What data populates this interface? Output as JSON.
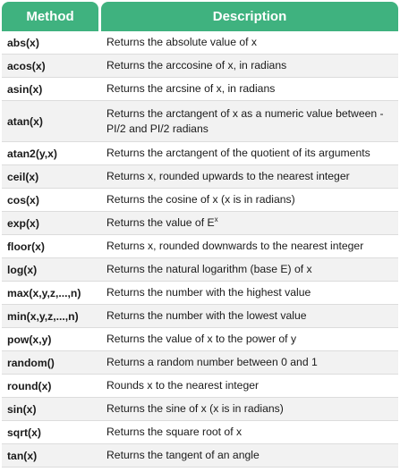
{
  "header": {
    "method": "Method",
    "description": "Description"
  },
  "rows": [
    {
      "method": "abs(x)",
      "description": "Returns the absolute value of x"
    },
    {
      "method": "acos(x)",
      "description": "Returns the arccosine of x, in radians"
    },
    {
      "method": "asin(x)",
      "description": "Returns the arcsine of x, in radians"
    },
    {
      "method": "atan(x)",
      "description": "Returns the arctangent of x as a numeric value between -PI/2 and PI/2 radians"
    },
    {
      "method": "atan2(y,x)",
      "description": "Returns the arctangent of the quotient of its arguments"
    },
    {
      "method": "ceil(x)",
      "description": "Returns x, rounded upwards to the nearest integer"
    },
    {
      "method": "cos(x)",
      "description": "Returns the cosine of x (x is in radians)"
    },
    {
      "method": "exp(x)",
      "description": "Returns the value of E",
      "superscript": "x"
    },
    {
      "method": "floor(x)",
      "description": "Returns x, rounded downwards to the nearest integer"
    },
    {
      "method": "log(x)",
      "description": "Returns the natural logarithm (base E) of x"
    },
    {
      "method": "max(x,y,z,...,n)",
      "description": "Returns the number with the highest value"
    },
    {
      "method": "min(x,y,z,...,n)",
      "description": "Returns the number with the lowest value"
    },
    {
      "method": "pow(x,y)",
      "description": "Returns the value of x to the power of y"
    },
    {
      "method": "random()",
      "description": "Returns a random number between 0 and 1"
    },
    {
      "method": "round(x)",
      "description": "Rounds x to the nearest integer"
    },
    {
      "method": "sin(x)",
      "description": "Returns the sine of x (x is in radians)"
    },
    {
      "method": "sqrt(x)",
      "description": "Returns the square root of x"
    },
    {
      "method": "tan(x)",
      "description": "Returns the tangent of an angle"
    }
  ]
}
